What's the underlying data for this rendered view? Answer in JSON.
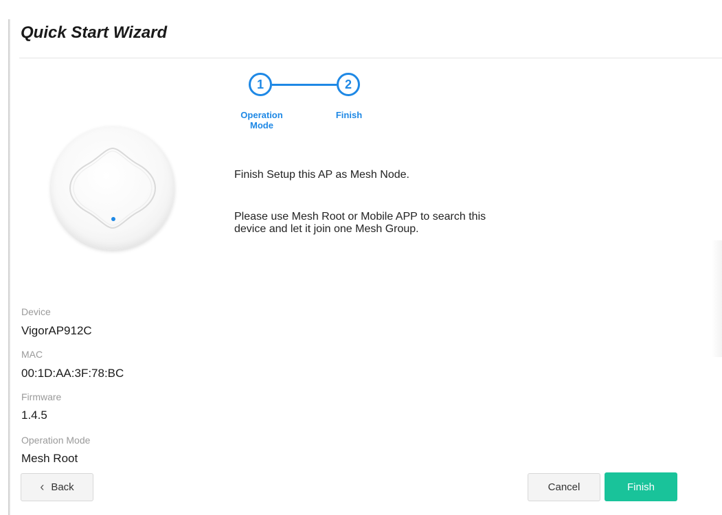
{
  "wizard": {
    "title": "Quick Start Wizard"
  },
  "stepper": {
    "steps": [
      {
        "number": "1",
        "label_line1": "Operation",
        "label_line2": "Mode"
      },
      {
        "number": "2",
        "label_line1": "Finish",
        "label_line2": ""
      }
    ],
    "accent_color": "#1e88e5"
  },
  "messages": {
    "finish": "Finish Setup this AP as Mesh Node.",
    "instruction_line1": "Please use Mesh Root or Mobile APP to search this",
    "instruction_line2": "device and let it join one Mesh Group."
  },
  "device_info": {
    "device_label": "Device",
    "device_value": "VigorAP912C",
    "mac_label": "MAC",
    "mac_value": "00:1D:AA:3F:78:BC",
    "firmware_label": "Firmware",
    "firmware_value": "1.4.5",
    "mode_label": "Operation Mode",
    "mode_value": "Mesh Root"
  },
  "buttons": {
    "back": "Back",
    "back_icon": "chevron-left-icon",
    "cancel": "Cancel",
    "finish": "Finish",
    "finish_color": "#19c39a"
  }
}
